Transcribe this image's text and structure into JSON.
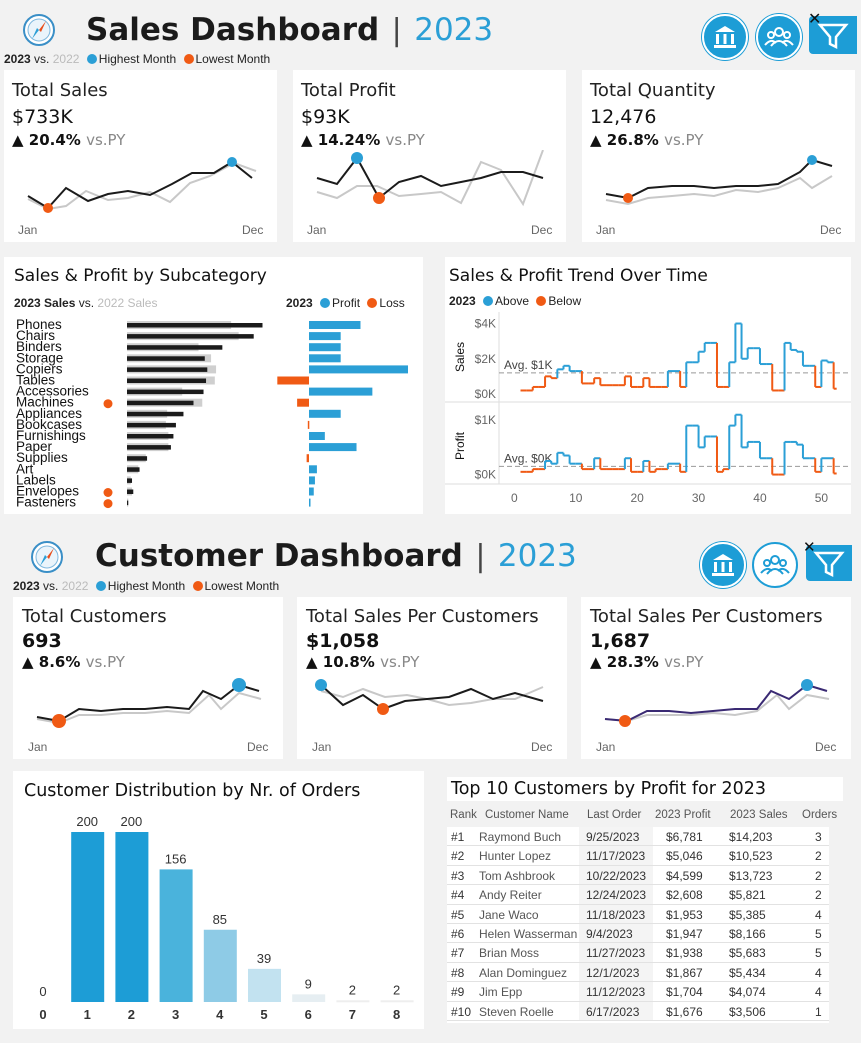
{
  "sales_dashboard": {
    "title": "Sales Dashboard",
    "separator": "|",
    "year": "2023",
    "legend": {
      "current": "2023",
      "vs": "vs.",
      "previous": "2022",
      "highest": "Highest Month",
      "lowest": "Lowest Month"
    },
    "kpis": [
      {
        "title": "Total Sales",
        "value": "$733K",
        "arrow": "▲",
        "change": "20.4%",
        "vs": "vs.PY",
        "start": "Jan",
        "end": "Dec"
      },
      {
        "title": "Total Profit",
        "value": "$93K",
        "arrow": "▲",
        "change": "14.24%",
        "vs": "vs.PY",
        "start": "Jan",
        "end": "Dec"
      },
      {
        "title": "Total Quantity",
        "value": "12,476",
        "arrow": "▲",
        "change": "26.8%",
        "vs": "vs.PY",
        "start": "Jan",
        "end": "Dec"
      }
    ],
    "subcategory": {
      "title": "Sales & Profit by Subcategory",
      "legend_left": {
        "current": "2023 Sales",
        "vs": "vs.",
        "previous": "2022 Sales"
      },
      "legend_right": {
        "year": "2023",
        "profit": "Profit",
        "loss": "Loss"
      }
    },
    "trend": {
      "title": "Sales & Profit Trend Over  Time",
      "legend": {
        "year": "2023",
        "above": "Above",
        "below": "Below"
      },
      "sales_axis": {
        "label": "Sales",
        "ticks": [
          "$4K",
          "$2K",
          "$0K"
        ],
        "avg": "Avg. $1K"
      },
      "profit_axis": {
        "label": "Profit",
        "ticks": [
          "$1K",
          "$0K"
        ],
        "avg": "Avg. $0K"
      },
      "x_ticks": [
        "0",
        "10",
        "20",
        "30",
        "40",
        "50"
      ]
    }
  },
  "customer_dashboard": {
    "title": "Customer Dashboard",
    "separator": "|",
    "year": "2023",
    "legend": {
      "current": "2023",
      "vs": "vs.",
      "previous": "2022",
      "highest": "Highest Month",
      "lowest": "Lowest Month"
    },
    "kpis": [
      {
        "title": "Total Customers",
        "value": "693",
        "arrow": "▲",
        "change": "8.6%",
        "vs": "vs.PY",
        "start": "Jan",
        "end": "Dec"
      },
      {
        "title": "Total Sales Per Customers",
        "value": "$1,058",
        "arrow": "▲",
        "change": "10.8%",
        "vs": "vs.PY",
        "start": "Jan",
        "end": "Dec"
      },
      {
        "title": "Total Sales Per Customers",
        "value": "1,687",
        "arrow": "▲",
        "change": "28.3%",
        "vs": "vs.PY",
        "start": "Jan",
        "end": "Dec"
      }
    ],
    "distribution_title": "Customer Distribution by Nr. of Orders",
    "top10": {
      "title": "Top 10 Customers by Profit for 2023",
      "headers": [
        "Rank",
        "Customer Name",
        "Last Order",
        "2023 Profit",
        "2023 Sales",
        "Orders"
      ],
      "rows": [
        [
          "#1",
          "Raymond Buch",
          "9/25/2023",
          "$6,781",
          "$14,203",
          "3"
        ],
        [
          "#2",
          "Hunter Lopez",
          "11/17/2023",
          "$5,046",
          "$10,523",
          "2"
        ],
        [
          "#3",
          "Tom Ashbrook",
          "10/22/2023",
          "$4,599",
          "$13,723",
          "2"
        ],
        [
          "#4",
          "Andy Reiter",
          "12/24/2023",
          "$2,608",
          "$5,821",
          "2"
        ],
        [
          "#5",
          "Jane Waco",
          "11/18/2023",
          "$1,953",
          "$5,385",
          "4"
        ],
        [
          "#6",
          "Helen Wasserman",
          "9/4/2023",
          "$1,947",
          "$8,166",
          "5"
        ],
        [
          "#7",
          "Brian Moss",
          "11/27/2023",
          "$1,938",
          "$5,683",
          "5"
        ],
        [
          "#8",
          "Alan Dominguez",
          "12/1/2023",
          "$1,867",
          "$5,434",
          "4"
        ],
        [
          "#9",
          "Jim Epp",
          "11/12/2023",
          "$1,704",
          "$4,074",
          "4"
        ],
        [
          "#10",
          "Steven Roelle",
          "6/17/2023",
          "$1,676",
          "$3,506",
          "1"
        ]
      ]
    }
  },
  "icons": [
    "compass-icon",
    "bank-icon",
    "people-icon",
    "filter-icon",
    "close-icon"
  ],
  "colors": {
    "accent": "#1d9dd6",
    "above": "#2b9fd6",
    "below": "#f05a14",
    "current": "#1b1b1b",
    "previous": "#c8c8c8"
  },
  "chart_data": [
    {
      "type": "bar",
      "name_ref": "subcategory_sales",
      "categories": [
        "Phones",
        "Chairs",
        "Binders",
        "Storage",
        "Copiers",
        "Tables",
        "Accessories",
        "Machines",
        "Appliances",
        "Bookcases",
        "Furnishings",
        "Paper",
        "Supplies",
        "Art",
        "Labels",
        "Envelopes",
        "Fasteners"
      ],
      "series": [
        {
          "name": "2023 Sales",
          "values": [
            108,
            101,
            76,
            62,
            64,
            63,
            61,
            53,
            45,
            39,
            37,
            35,
            16,
            10,
            4,
            5,
            1
          ]
        },
        {
          "name": "2022 Sales",
          "values": [
            83,
            89,
            57,
            67,
            71,
            70,
            44,
            60,
            32,
            31,
            33,
            33,
            15,
            9,
            3,
            4,
            1
          ]
        }
      ],
      "loss_marked": [
        "Machines",
        "Envelopes",
        "Fasteners"
      ]
    },
    {
      "type": "bar",
      "name_ref": "subcategory_profit",
      "categories": [
        "Phones",
        "Chairs",
        "Binders",
        "Storage",
        "Copiers",
        "Tables",
        "Accessories",
        "Machines",
        "Appliances",
        "Bookcases",
        "Furnishings",
        "Paper",
        "Supplies",
        "Art",
        "Labels",
        "Envelopes",
        "Fasteners"
      ],
      "series": [
        {
          "name": "Profit",
          "values": [
            13,
            8,
            8,
            8,
            25,
            -8,
            16,
            -3,
            8,
            -0.3,
            4,
            12,
            -0.6,
            2,
            1.5,
            1.2,
            0.2
          ]
        }
      ]
    },
    {
      "type": "line",
      "name_ref": "sales_trend_weekly",
      "x": [
        1,
        2,
        3,
        4,
        5,
        6,
        7,
        8,
        9,
        10,
        11,
        12,
        13,
        14,
        15,
        16,
        17,
        18,
        19,
        20,
        21,
        22,
        23,
        24,
        25,
        26,
        27,
        28,
        29,
        30,
        31,
        32,
        33,
        34,
        35,
        36,
        37,
        38,
        39,
        40,
        41,
        42,
        43,
        44,
        45,
        46,
        47,
        48,
        49,
        50,
        51,
        52
      ],
      "series": [
        {
          "name": "2023",
          "values": [
            0.2,
            0.2,
            0.4,
            0.4,
            1.0,
            0.9,
            1.4,
            1.6,
            1.3,
            1.3,
            0.6,
            0.6,
            0.9,
            0.5,
            0.5,
            0.5,
            0.5,
            1.0,
            0.4,
            0.4,
            0.9,
            0.4,
            0.4,
            0.4,
            1.3,
            1.3,
            0.4,
            1.8,
            1.8,
            2.4,
            2.9,
            2.9,
            0.4,
            0.4,
            1.8,
            4.0,
            2.0,
            2.6,
            2.6,
            1.7,
            1.7,
            0.2,
            0.2,
            2.9,
            2.5,
            2.4,
            1.6,
            1.6,
            0.4,
            1.9,
            1.8,
            0.3
          ]
        }
      ],
      "avg": 1.2,
      "ylim": [
        0,
        4.2
      ]
    },
    {
      "type": "line",
      "name_ref": "profit_trend_weekly",
      "x": [
        1,
        2,
        3,
        4,
        5,
        6,
        7,
        8,
        9,
        10,
        11,
        12,
        13,
        14,
        15,
        16,
        17,
        18,
        19,
        20,
        21,
        22,
        23,
        24,
        25,
        26,
        27,
        28,
        29,
        30,
        31,
        32,
        33,
        34,
        35,
        36,
        37,
        38,
        39,
        40,
        41,
        42,
        43,
        44,
        45,
        46,
        47,
        48,
        49,
        50,
        51,
        52
      ],
      "series": [
        {
          "name": "2023",
          "values": [
            0.05,
            0.05,
            0.1,
            0.1,
            0.25,
            0.2,
            0.4,
            0.35,
            0.2,
            0.2,
            0.1,
            0.1,
            0.3,
            0.1,
            0.1,
            0.1,
            0.1,
            0.3,
            0.05,
            0.05,
            0.25,
            0.05,
            0.1,
            0.1,
            0.2,
            0.2,
            0.05,
            0.9,
            0.9,
            0.5,
            0.7,
            0.7,
            0.05,
            0.1,
            0.9,
            1.1,
            0.5,
            0.6,
            0.6,
            0.3,
            0.3,
            0.0,
            0.0,
            0.6,
            0.6,
            0.55,
            0.3,
            0.3,
            0.05,
            0.3,
            0.3,
            0.02
          ]
        }
      ],
      "avg": 0.15,
      "ylim": [
        -0.1,
        1.15
      ]
    },
    {
      "type": "bar",
      "name_ref": "customer_distribution",
      "categories": [
        "0",
        "1",
        "2",
        "3",
        "4",
        "5",
        "6",
        "7",
        "8"
      ],
      "values": [
        0,
        200,
        200,
        156,
        85,
        39,
        9,
        2,
        2
      ]
    }
  ]
}
